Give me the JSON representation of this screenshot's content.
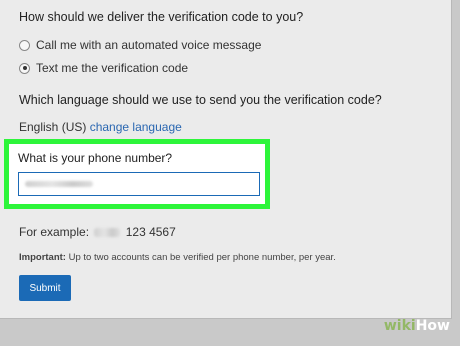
{
  "delivery": {
    "question": "How should we deliver the verification code to you?",
    "options": [
      {
        "label": "Call me with an automated voice message",
        "checked": false
      },
      {
        "label": "Text me the verification code",
        "checked": true
      }
    ]
  },
  "language": {
    "question": "Which language should we use to send you the verification code?",
    "current": "English (US)",
    "change_link": "change language"
  },
  "phone": {
    "label": "What is your phone number?",
    "value": "",
    "example_prefix": "For example:",
    "example_number": "123 4567"
  },
  "notice": {
    "strong": "Important:",
    "text": " Up to two accounts can be verified per phone number, per year."
  },
  "submit": {
    "label": "Submit"
  },
  "watermark": {
    "wiki": "wiki",
    "how": "How"
  },
  "colors": {
    "highlight": "#2df53a",
    "link": "#2a67b1",
    "button": "#1b6ab6"
  }
}
